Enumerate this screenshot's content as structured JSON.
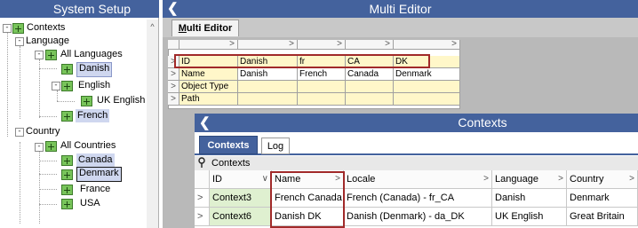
{
  "left_panel": {
    "title": "System Setup",
    "tree": {
      "contexts": "Contexts",
      "language": "Language",
      "all_languages": "All Languages",
      "danish": "Danish",
      "english": "English",
      "uk_english": "UK English",
      "french": "French",
      "country": "Country",
      "all_countries": "All Countries",
      "canada": "Canada",
      "denmark": "Denmark",
      "france": "France",
      "usa": "USA"
    }
  },
  "multi_editor": {
    "title": "Multi Editor",
    "tab_label_first": "M",
    "tab_label_rest": "ulti Editor",
    "header_arrows": [
      ">",
      ">",
      ">",
      ">",
      ">"
    ],
    "rows": [
      {
        "label": "ID",
        "values": [
          "Danish",
          "fr",
          "CA",
          "DK"
        ]
      },
      {
        "label": "Name",
        "values": [
          "Danish",
          "French",
          "Canada",
          "Denmark"
        ]
      },
      {
        "label": "Object Type",
        "values": [
          "",
          "",
          "",
          ""
        ]
      },
      {
        "label": "Path",
        "values": [
          "",
          "",
          "",
          ""
        ]
      }
    ],
    "row_marker": ">"
  },
  "contexts_window": {
    "title": "Contexts",
    "tabs": {
      "contexts": "Contexts",
      "log": "Log"
    },
    "pin_icon": "pin-icon",
    "group_label": "Contexts",
    "columns": [
      "ID",
      "Name",
      "Locale",
      "Language",
      "Country"
    ],
    "rows": [
      {
        "id": "Context3",
        "name": "French Canada",
        "locale": "French (Canada) - fr_CA",
        "language": "Danish",
        "country": "Denmark"
      },
      {
        "id": "Context6",
        "name": "Danish DK",
        "locale": "Danish (Denmark) - da_DK",
        "language": "UK English",
        "country": "Great Britain"
      }
    ],
    "row_marker": ">"
  },
  "colors": {
    "header_blue": "#44629d",
    "highlight_red": "#a12a2a",
    "yellow_cell": "#fff7c9",
    "green_cell": "#dff0d0"
  }
}
